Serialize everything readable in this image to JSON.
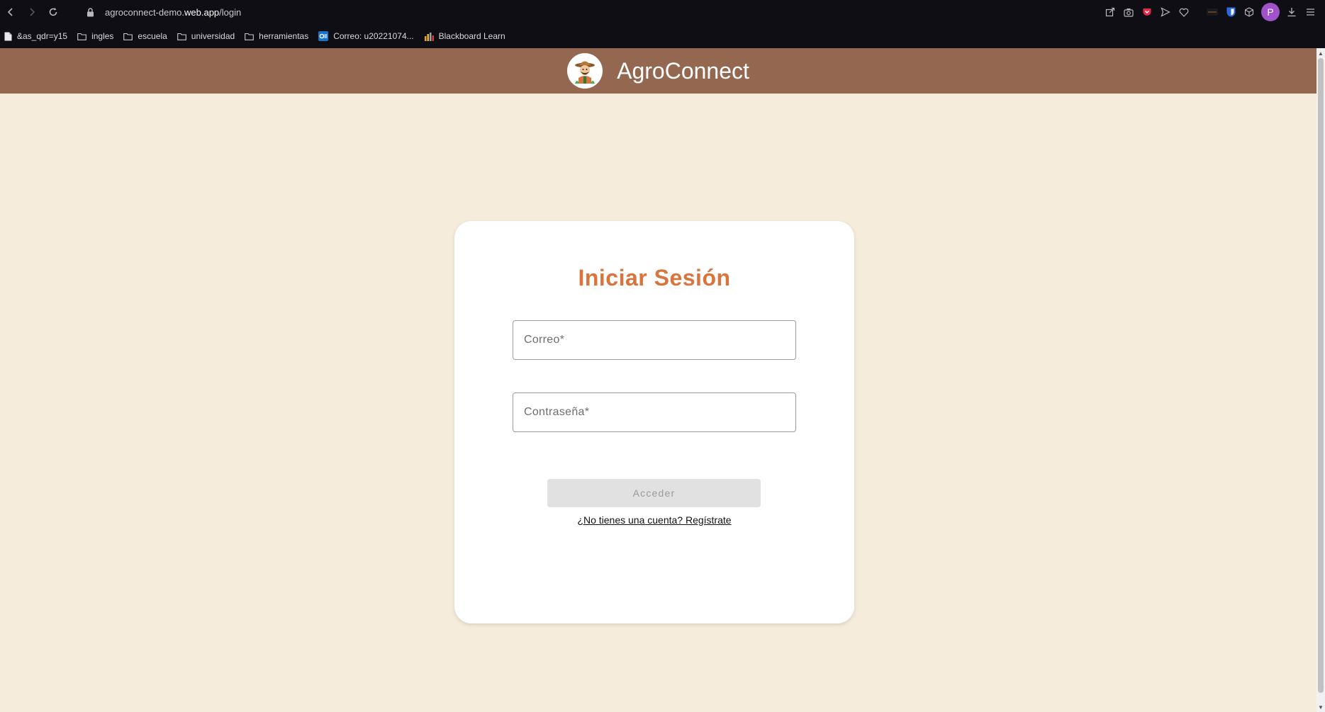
{
  "browser": {
    "url_prefix": "agroconnect-demo.",
    "url_domain": "web.app",
    "url_path": "/login",
    "profile_initial": "P"
  },
  "bookmarks": [
    {
      "label": "&as_qdr=y15",
      "icon": "page-icon"
    },
    {
      "label": "ingles",
      "icon": "folder-icon"
    },
    {
      "label": "escuela",
      "icon": "folder-icon"
    },
    {
      "label": "universidad",
      "icon": "folder-icon"
    },
    {
      "label": "herramientas",
      "icon": "folder-icon"
    },
    {
      "label": "Correo: u20221074...",
      "icon": "outlook-icon"
    },
    {
      "label": "Blackboard Learn",
      "icon": "blackboard-icon"
    }
  ],
  "app": {
    "brand": "AgroConnect",
    "colors": {
      "header": "#936750",
      "background": "#f5ecdc",
      "title": "#d9743c"
    }
  },
  "login": {
    "title": "Iniciar Sesión",
    "email_placeholder": "Correo*",
    "password_placeholder": "Contraseña*",
    "submit_label": "Acceder",
    "register_link": "¿No tienes una cuenta? Regístrate"
  }
}
